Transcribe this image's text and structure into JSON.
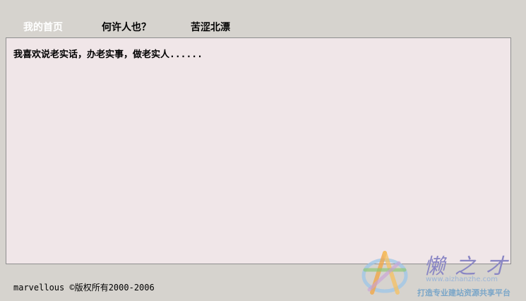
{
  "nav": {
    "items": [
      {
        "label": "我的首页",
        "active": true
      },
      {
        "label": "何许人也？",
        "active": false
      },
      {
        "label": "苦涩北漂",
        "active": false
      }
    ]
  },
  "content": {
    "text": "我喜欢说老实话，办老实事，做老实人......"
  },
  "footer": {
    "text": "marvellous ©版权所有2000-2006"
  },
  "watermark": {
    "name": "懒之才",
    "url": "www.aizhanzhe.com",
    "slogan": "打造专业建站资源共享平台"
  }
}
